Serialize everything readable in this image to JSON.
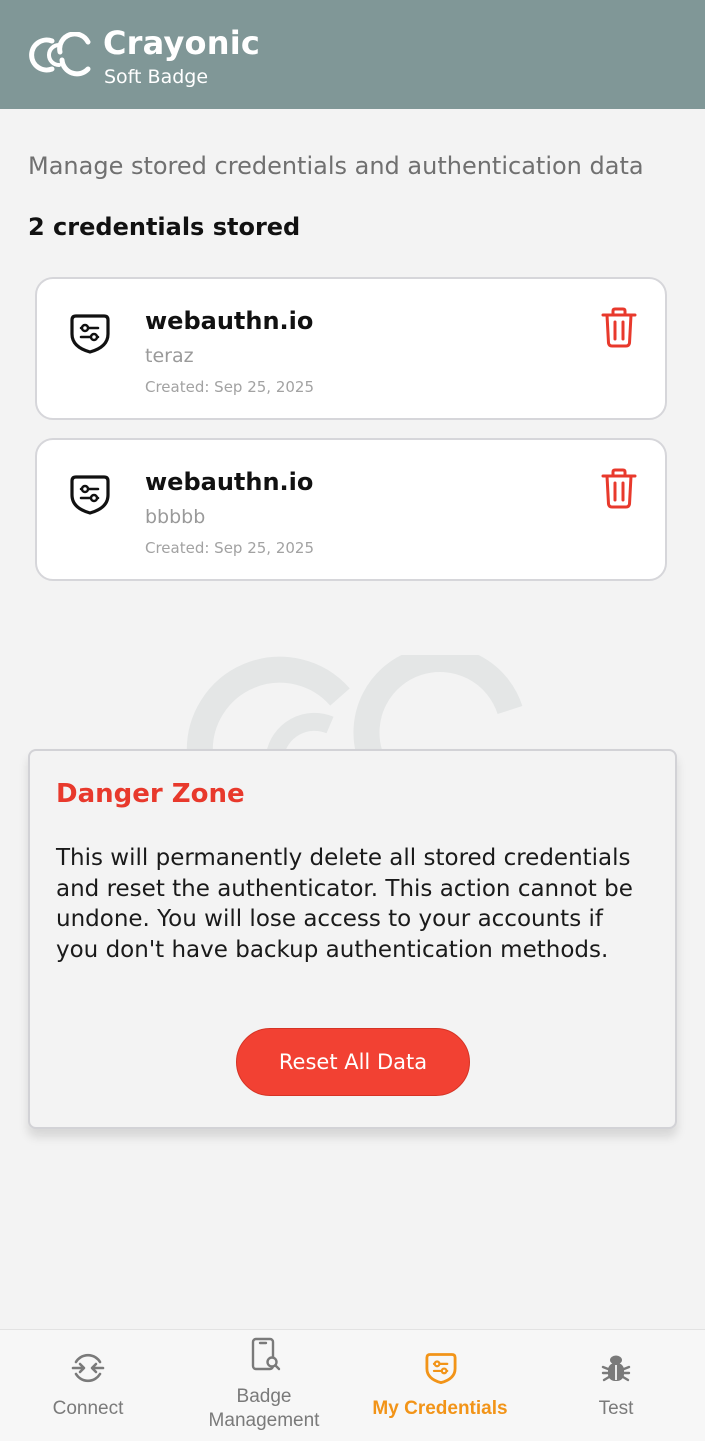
{
  "header": {
    "brand": "Crayonic",
    "subtitle": "Soft Badge",
    "header_color": "#809797"
  },
  "main": {
    "description": "Manage stored credentials and authentication data",
    "count_label": "2 credentials stored"
  },
  "credentials": [
    {
      "site": "webauthn.io",
      "user": "teraz",
      "created": "Created: Sep 25, 2025",
      "icon": "passkey-icon",
      "action_icon": "trash-icon"
    },
    {
      "site": "webauthn.io",
      "user": "bbbbb",
      "created": "Created: Sep 25, 2025",
      "icon": "passkey-icon",
      "action_icon": "trash-icon"
    }
  ],
  "danger_zone": {
    "title": "Danger Zone",
    "text": "This will permanently delete all stored credentials and reset the authenticator. This action cannot be undone. You will lose access to your accounts if you don't have backup authentication methods.",
    "button_label": "Reset All Data",
    "accent_color": "#e8392c"
  },
  "nav": {
    "items": [
      {
        "label": "Connect",
        "icon": "connect-icon",
        "active": false
      },
      {
        "label": "Badge\nManagement",
        "icon": "badge-search-icon",
        "active": false
      },
      {
        "label": "My Credentials",
        "icon": "credentials-icon",
        "active": true
      },
      {
        "label": "Test",
        "icon": "bug-icon",
        "active": false
      }
    ],
    "active_color": "#f29418"
  }
}
